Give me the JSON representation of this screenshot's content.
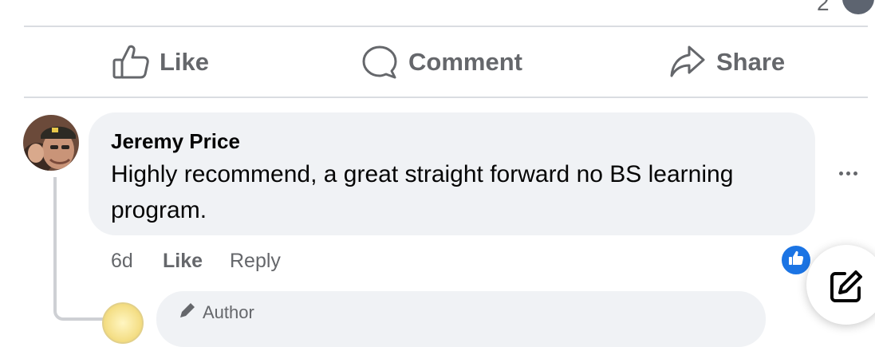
{
  "top": {
    "reaction_count": "2"
  },
  "actions": {
    "like_label": "Like",
    "comment_label": "Comment",
    "share_label": "Share"
  },
  "comment": {
    "author": "Jeremy Price",
    "text": "Highly recommend, a great straight forward no BS learning program.",
    "time": "6d",
    "like_label": "Like",
    "reply_label": "Reply",
    "reaction": "like-icon"
  },
  "reply": {
    "badge_label": "Author"
  },
  "colors": {
    "accent": "#1b74e4",
    "bubble": "#f0f2f5",
    "muted_text": "#65676b",
    "divider": "#dadde1"
  }
}
